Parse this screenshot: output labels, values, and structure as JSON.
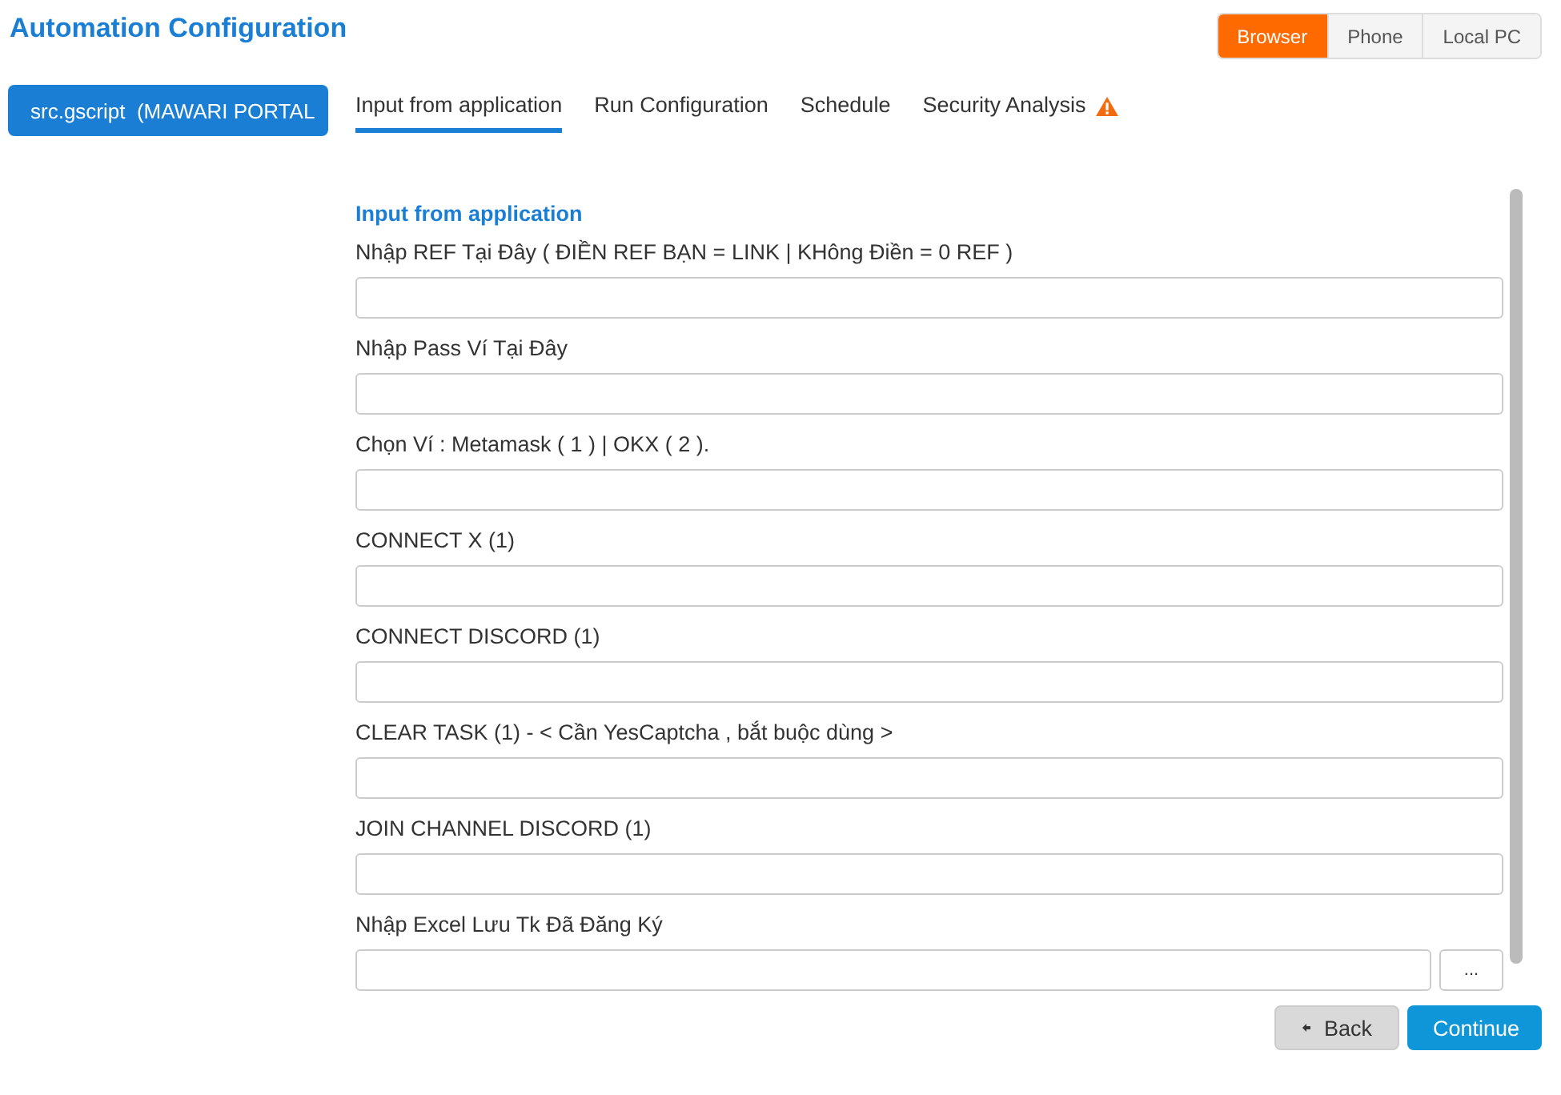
{
  "title": "Automation Configuration",
  "modes": [
    {
      "label": "Browser",
      "selected": true
    },
    {
      "label": "Phone",
      "selected": false
    },
    {
      "label": "Local PC",
      "selected": false
    }
  ],
  "script_button": "src.gscript  (MAWARI PORTAL",
  "tabs": [
    {
      "label": "Input from application",
      "selected": true,
      "warning": false
    },
    {
      "label": "Run Configuration",
      "selected": false,
      "warning": false
    },
    {
      "label": "Schedule",
      "selected": false,
      "warning": false
    },
    {
      "label": "Security Analysis",
      "selected": false,
      "warning": true
    }
  ],
  "section_title": "Input from application",
  "fields": [
    {
      "kind": "text",
      "label": "Nhập REF Tại Đây ( ĐIỀN REF BẠN = LINK | KHông Điền = 0 REF )"
    },
    {
      "kind": "text",
      "label": "Nhập Pass Ví Tại Đây"
    },
    {
      "kind": "text",
      "label": "Chọn Ví : Metamask ( 1 ) | OKX ( 2 )."
    },
    {
      "kind": "text",
      "label": "CONNECT X (1)"
    },
    {
      "kind": "text",
      "label": "CONNECT DISCORD (1)"
    },
    {
      "kind": "text",
      "label": "CLEAR TASK (1) - < Cần YesCaptcha , bắt buộc dùng >"
    },
    {
      "kind": "text",
      "label": "JOIN CHANNEL DISCORD (1)"
    },
    {
      "kind": "file",
      "label": "Nhập Excel Lưu Tk Đã Đăng Ký",
      "browse": "..."
    }
  ],
  "buttons": [
    {
      "kind": "back",
      "label": "Back"
    },
    {
      "kind": "primary",
      "label": "Continue"
    }
  ]
}
